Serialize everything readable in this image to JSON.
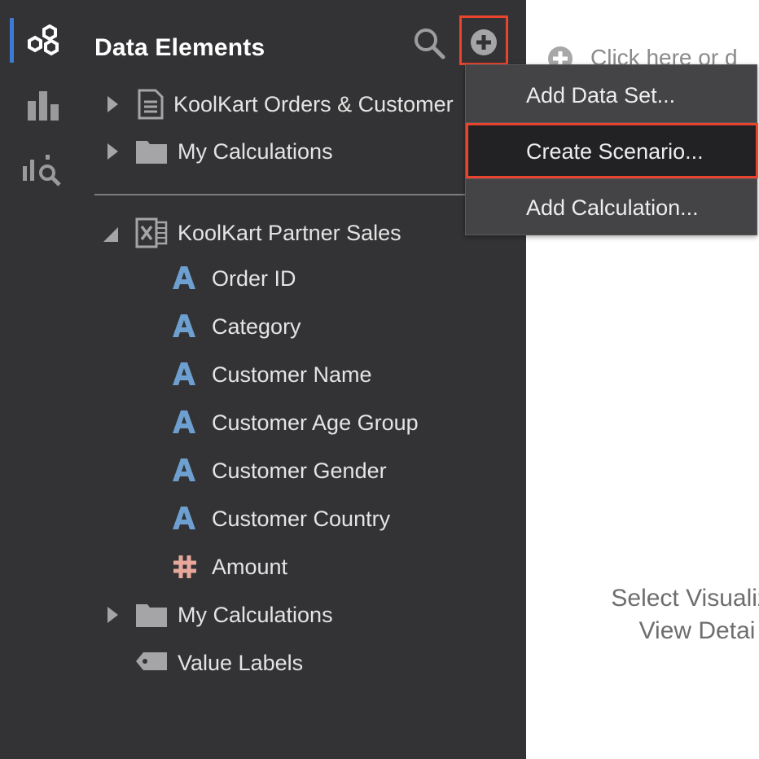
{
  "left_rail": {
    "items": [
      {
        "name": "data-icon",
        "active": true
      },
      {
        "name": "visualizations-icon",
        "active": false
      },
      {
        "name": "analytics-icon",
        "active": false
      }
    ],
    "active_color": "#3a7bd5"
  },
  "panel": {
    "title": "Data Elements",
    "search_icon": "search-icon",
    "add_icon": "plus-circle-icon",
    "tree_top": [
      {
        "label": "KoolKart Orders & Customer",
        "icon": "document-icon",
        "expanded": false
      },
      {
        "label": "My Calculations",
        "icon": "folder-icon",
        "expanded": false
      }
    ],
    "dataset": {
      "label": "KoolKart Partner Sales",
      "icon": "excel-icon",
      "expanded": true,
      "columns": [
        {
          "label": "Order ID",
          "type": "attribute"
        },
        {
          "label": "Category",
          "type": "attribute"
        },
        {
          "label": "Customer Name",
          "type": "attribute"
        },
        {
          "label": "Customer Age Group",
          "type": "attribute"
        },
        {
          "label": "Customer Gender",
          "type": "attribute"
        },
        {
          "label": "Customer Country",
          "type": "attribute"
        },
        {
          "label": "Amount",
          "type": "measure"
        }
      ],
      "calculations_label": "My Calculations",
      "value_labels_label": "Value Labels"
    }
  },
  "add_menu": {
    "items": [
      {
        "label": "Add Data Set...",
        "selected": false
      },
      {
        "label": "Create Scenario...",
        "selected": true
      },
      {
        "label": "Add Calculation...",
        "selected": false
      }
    ]
  },
  "canvas": {
    "hint": "Click here or d",
    "message_line1": "Select Visualiza",
    "message_line2": "View Detai"
  },
  "colors": {
    "panel_bg": "#333335",
    "highlight": "#e8442e",
    "attribute_icon": "#6d9fd0",
    "measure_icon": "#e8a79b"
  }
}
